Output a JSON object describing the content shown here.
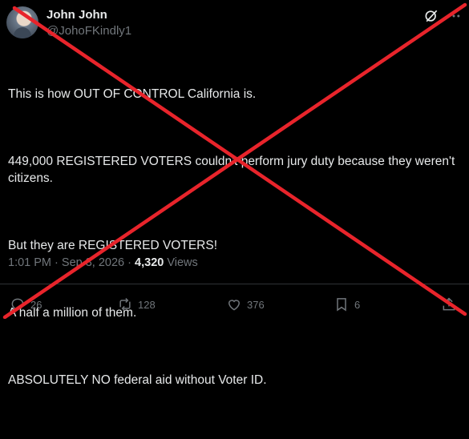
{
  "author": {
    "name": "John John",
    "handle": "@JohoFKindly1"
  },
  "post": {
    "paragraphs": [
      "This is how OUT OF CONTROL California is.",
      "449,000 REGISTERED VOTERS couldn't perform jury duty because they weren't citizens.",
      "But they are REGISTERED VOTERS!",
      "A half a million of them.",
      "ABSOLUTELY NO federal aid without Voter ID."
    ],
    "time": "1:01 PM",
    "separator": "·",
    "date": "Sep 3, 2026",
    "views_count": "4,320",
    "views_label": "Views"
  },
  "actions": {
    "replies": "26",
    "reposts": "128",
    "likes": "376",
    "bookmarks": "6"
  },
  "icons": [
    "grok-icon",
    "more-icon",
    "reply-icon",
    "repost-icon",
    "like-icon",
    "bookmark-icon",
    "share-icon"
  ],
  "colors": {
    "background": "#000000",
    "text": "#e7e9ea",
    "muted": "#71767b",
    "overlay_cross": "#e8242b"
  }
}
